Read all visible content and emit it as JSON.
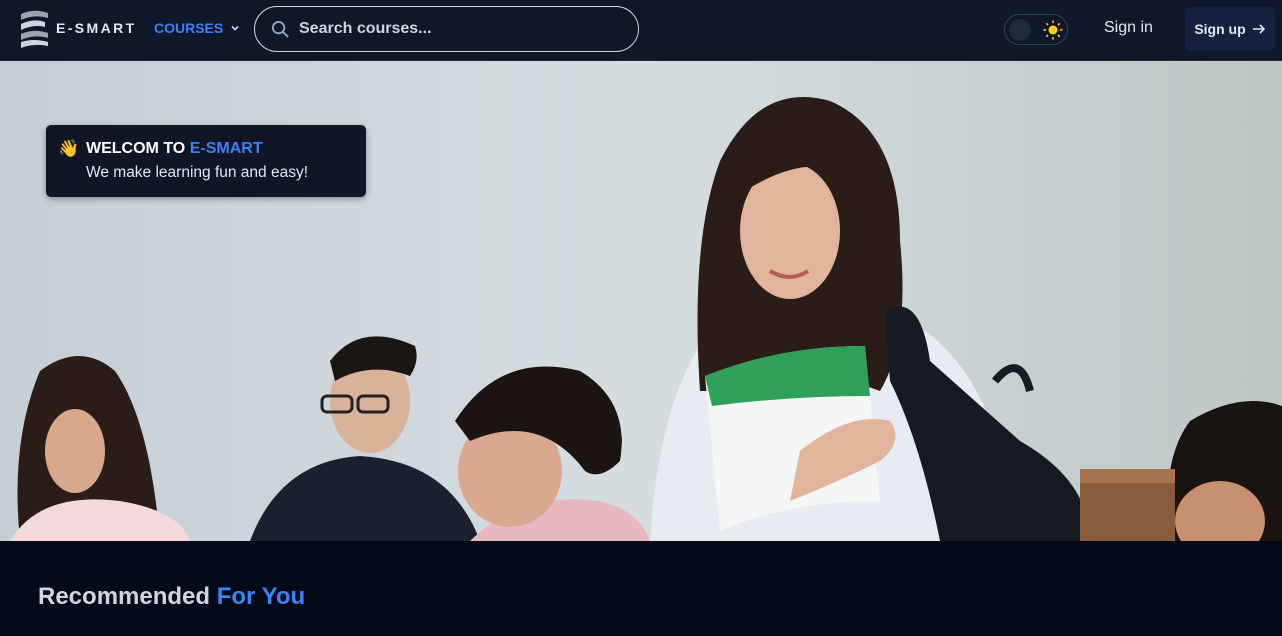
{
  "navbar": {
    "brand": "E-SMART",
    "courses_label": "COURSES",
    "search_placeholder": "Search courses...",
    "signin_label": "Sign in",
    "signup_label": "Sign up"
  },
  "hero": {
    "welcome_prefix": "WELCOM TO ",
    "welcome_brand": "E-SMART",
    "tagline": "We make learning fun and easy!",
    "wave_emoji": "👋"
  },
  "recommended": {
    "title_prefix": "Recommended ",
    "title_accent": "For You"
  },
  "icons": {
    "logo": "e-smart-logo-icon",
    "dropdown": "chevron-down-icon",
    "search": "search-icon",
    "theme": "sun-icon",
    "arrow": "arrow-right-icon"
  },
  "colors": {
    "accent": "#3b82f6",
    "navbar_bg": "#0f172a",
    "page_bg": "#050a18",
    "signup_bg": "#15223f"
  }
}
